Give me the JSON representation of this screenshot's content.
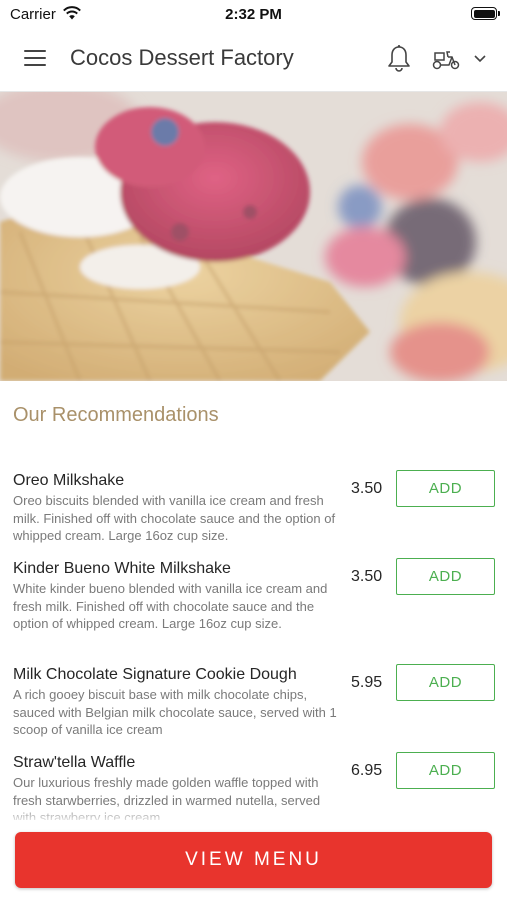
{
  "status_bar": {
    "carrier": "Carrier",
    "time": "2:32 PM"
  },
  "header": {
    "title": "Cocos Dessert Factory"
  },
  "icons": {
    "menu": "hamburger-menu-icon",
    "notifications": "bell-icon",
    "delivery": "scooter-icon",
    "dropdown": "chevron-down-icon"
  },
  "hero": {
    "image": "waffle-with-berries-photo"
  },
  "recommendations": {
    "title": "Our Recommendations",
    "items": [
      {
        "name": "Oreo Milkshake",
        "description": "Oreo biscuits blended with vanilla ice cream and fresh milk. Finished off with chocolate  sauce and the option of whipped cream. Large 16oz cup size.",
        "price": "3.50",
        "button": "ADD"
      },
      {
        "name": "Kinder Bueno White Milkshake",
        "description": "White kinder bueno blended with vanilla ice cream and fresh milk. Finished off with chocolate  sauce and the option of whipped cream. Large 16oz cup size.",
        "price": "3.50",
        "button": "ADD"
      },
      {
        "name": "Milk Chocolate Signature Cookie Dough",
        "description": "A rich gooey biscuit base with milk chocolate chips, sauced with Belgian milk chocolate sauce, served with 1 scoop of vanilla ice cream",
        "price": "5.95",
        "button": "ADD"
      },
      {
        "name": "Straw'tella Waffle",
        "description": "Our luxurious freshly made golden waffle topped with fresh starwberries, drizzled in warmed nutella, served with strawberry ice cream.",
        "price": "6.95",
        "button": "ADD"
      }
    ]
  },
  "footer": {
    "view_menu_label": "VIEW MENU"
  },
  "colors": {
    "accent_red": "#e8342d",
    "add_green": "#4caf50",
    "section_gold": "#a9916a"
  }
}
